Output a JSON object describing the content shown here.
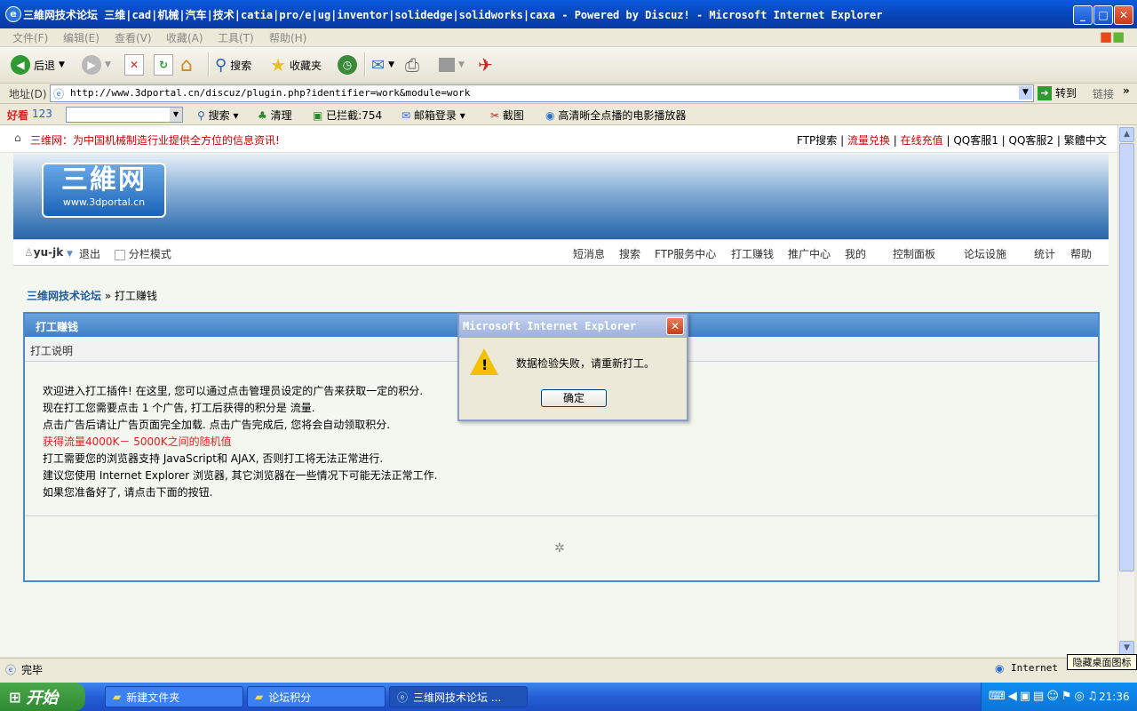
{
  "window": {
    "title": "三維网技术论坛 三维|cad|机械|汽车|技术|catia|pro/e|ug|inventor|solidedge|solidworks|caxa - Powered by Discuz! - Microsoft Internet Explorer",
    "minimize": "_",
    "maximize": "□",
    "close": "✕"
  },
  "menu": [
    "文件(F)",
    "编辑(E)",
    "查看(V)",
    "收藏(A)",
    "工具(T)",
    "帮助(H)"
  ],
  "toolbar": {
    "back": "后退",
    "search": "搜索",
    "favorites": "收藏夹"
  },
  "address": {
    "label": "地址(D)",
    "url": "http://www.3dportal.cn/discuz/plugin.php?identifier=work&module=work",
    "go": "转到",
    "links": "链接"
  },
  "toolbar2": {
    "brand": "123",
    "search": "搜索",
    "clean": "清理",
    "blocked": "已拦截:754",
    "mail_login": "邮箱登录",
    "screenshot": "截图",
    "player": "高清晰全点播的电影播放器"
  },
  "site": {
    "announcement": "三维网：为中国机械制造行业提供全方位的信息资讯!",
    "top_links": [
      "FTP搜索",
      "流量兑换",
      "在线充值",
      "QQ客服1",
      "QQ客服2",
      "繁體中文"
    ],
    "logo_big": "三維网",
    "logo_small": "www.3dportal.cn",
    "user": "yu-jk",
    "logout": "退出",
    "split_mode": "分栏模式",
    "nav": [
      "短消息",
      "搜索",
      "FTP服务中心",
      "打工赚钱",
      "推广中心",
      "我的",
      "控制面板",
      "论坛设施",
      "统计",
      "帮助"
    ],
    "breadcrumb_home": "三维网技术论坛",
    "breadcrumb_current": "» 打工赚钱"
  },
  "panel": {
    "title": "打工赚钱",
    "subtitle": "打工说明",
    "lines": [
      "欢迎进入打工插件! 在这里, 您可以通过点击管理员设定的广告来获取一定的积分.",
      "现在打工您需要点击  1 个广告, 打工后获得的积分是  流量.",
      "点击广告后请让广告页面完全加载. 点击广告完成后, 您将会自动领取积分.",
      "获得流量4000K－ 5000K之间的随机值",
      "打工需要您的浏览器支持  JavaScript和  AJAX, 否则打工将无法正常进行.",
      "建议您使用  Internet Explorer 浏览器, 其它浏览器在一些情况下可能无法正常工作.",
      "如果您准备好了, 请点击下面的按钮."
    ],
    "highlight_color": "#e02020"
  },
  "dialog": {
    "title": "Microsoft Internet Explorer",
    "message": "数据检验失败，请重新打工。",
    "ok": "确定"
  },
  "status": {
    "text": "完毕",
    "zone": "Internet",
    "tooltip": "隐藏桌面图标"
  },
  "taskbar": {
    "start": "开始",
    "tasks": [
      "新建文件夹",
      "论坛积分",
      "三维网技术论坛 ..."
    ],
    "time": "21:36"
  }
}
